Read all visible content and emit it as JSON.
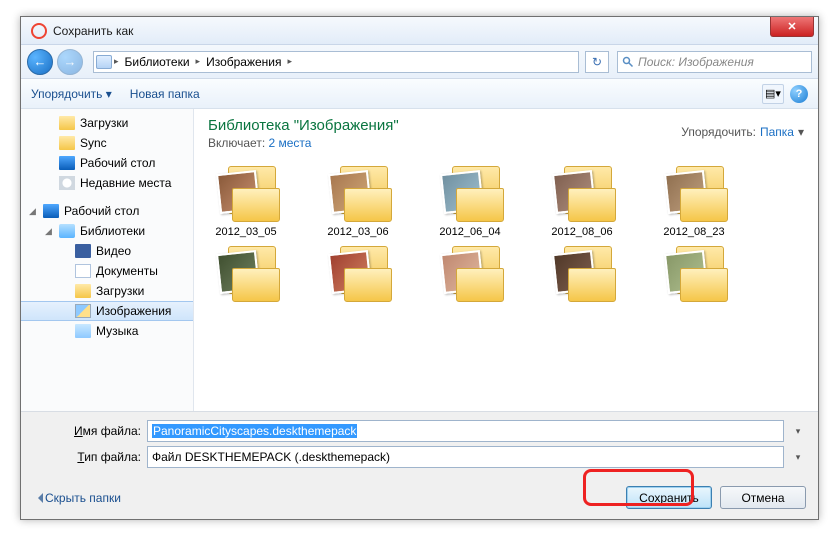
{
  "window": {
    "title": "Сохранить как"
  },
  "nav": {
    "crumbs": [
      "Библиотеки",
      "Изображения"
    ],
    "search_placeholder": "Поиск: Изображения"
  },
  "toolbar": {
    "organize": "Упорядочить",
    "new_folder": "Новая папка"
  },
  "sidebar": {
    "quick": [
      {
        "label": "Загрузки",
        "ico": "ico-folder"
      },
      {
        "label": "Sync",
        "ico": "ico-folder"
      },
      {
        "label": "Рабочий стол",
        "ico": "ico-desk"
      },
      {
        "label": "Недавние места",
        "ico": "ico-clock"
      }
    ],
    "desktop_label": "Рабочий стол",
    "libs_label": "Библиотеки",
    "libs": [
      {
        "label": "Видео",
        "ico": "ico-film"
      },
      {
        "label": "Документы",
        "ico": "ico-doc"
      },
      {
        "label": "Загрузки",
        "ico": "ico-folder"
      },
      {
        "label": "Изображения",
        "ico": "ico-img",
        "selected": true
      },
      {
        "label": "Музыка",
        "ico": "ico-music"
      }
    ]
  },
  "content": {
    "heading": "Библиотека \"Изображения\"",
    "sub_prefix": "Включает: ",
    "sub_link": "2 места",
    "arrange_label": "Упорядочить:",
    "arrange_value": "Папка",
    "folders_row1": [
      "2012_03_05",
      "2012_03_06",
      "2012_06_04",
      "2012_08_06",
      "2012_08_23"
    ],
    "folders_row2": [
      "",
      "",
      "",
      "",
      ""
    ]
  },
  "fields": {
    "name_label": "Имя файла:",
    "name_value": "PanoramicCityscapes.deskthemepack",
    "type_label": "Тип файла:",
    "type_value": "Файл DESKTHEMEPACK (.deskthemepack)"
  },
  "footer": {
    "hide": "Скрыть папки",
    "save": "Сохранить",
    "cancel": "Отмена"
  }
}
